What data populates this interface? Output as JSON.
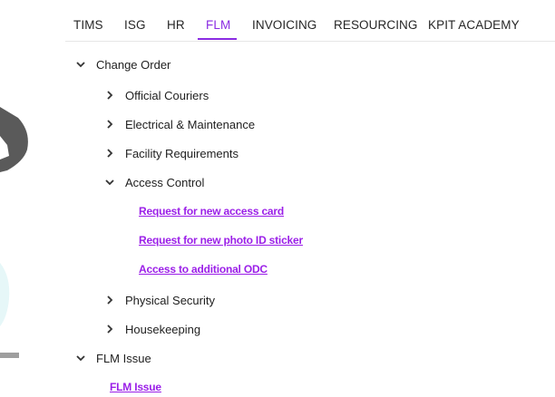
{
  "tabs": [
    {
      "label": "TIMS"
    },
    {
      "label": "ISG"
    },
    {
      "label": "HR"
    },
    {
      "label": "FLM"
    },
    {
      "label": "INVOICING"
    },
    {
      "label": "RESOURCING"
    },
    {
      "label": "KPIT ACADEMY"
    }
  ],
  "active_tab": "FLM",
  "accent_color": "#8a2be2",
  "tree": {
    "change_order": {
      "label": "Change Order",
      "expanded": true,
      "children": [
        {
          "label": "Official Couriers",
          "expanded": false
        },
        {
          "label": "Electrical & Maintenance",
          "expanded": false
        },
        {
          "label": "Facility Requirements",
          "expanded": false
        },
        {
          "label": "Access Control",
          "expanded": true,
          "links": [
            {
              "label": "Request for new access card"
            },
            {
              "label": "Request for new photo ID sticker"
            },
            {
              "label": "Access to additional ODC"
            }
          ]
        },
        {
          "label": "Physical Security",
          "expanded": false
        },
        {
          "label": "Housekeeping",
          "expanded": false
        }
      ]
    },
    "flm_issue": {
      "label": "FLM Issue",
      "expanded": true,
      "links": [
        {
          "label": "FLM Issue"
        }
      ]
    }
  },
  "icons": {
    "collapsed": "chevron-right-icon",
    "expanded": "chevron-down-icon"
  }
}
